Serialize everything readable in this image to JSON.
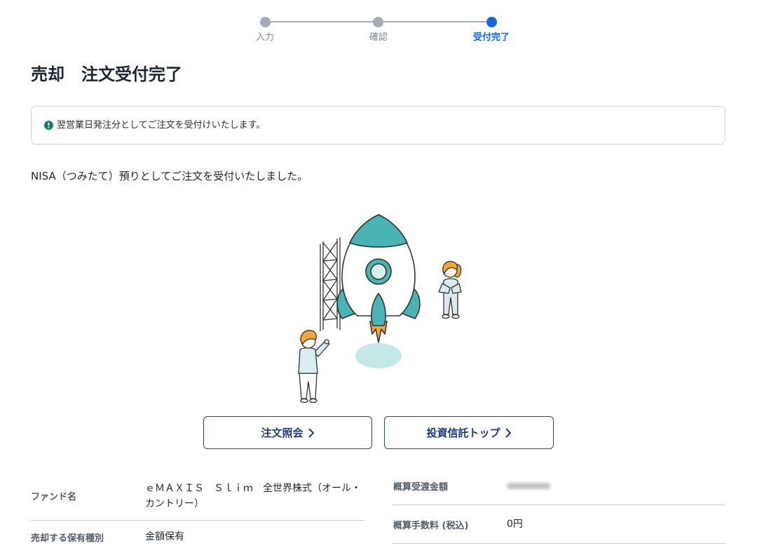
{
  "stepper": {
    "steps": [
      {
        "label": "入力",
        "state": "done"
      },
      {
        "label": "確認",
        "state": "done"
      },
      {
        "label": "受付完了",
        "state": "current"
      }
    ]
  },
  "page_title": "売却　注文受付完了",
  "notice": {
    "icon": "exclamation-circle-icon",
    "text": "翌営業日発注分としてご注文を受付けいたします。"
  },
  "message": "NISA（つみたて）預りとしてご注文を受付いたしました。",
  "illustration": {
    "icon": "rocket-launch-illustration"
  },
  "buttons": {
    "order_inquiry": "注文照会",
    "fund_top": "投資信託トップ",
    "chevron_icon": "chevron-right-icon"
  },
  "details_left": [
    {
      "label": "ファンド名",
      "value": "ｅＭＡＸＩＳ　Ｓｌｉｍ　全世界株式（オール・カントリー）"
    },
    {
      "label": "売却する保有種別",
      "value": "金額保有"
    }
  ],
  "details_right": [
    {
      "label": "概算受渡金額"
    },
    {
      "label": "概算手数料 (税込)",
      "value": "0円"
    }
  ],
  "colors": {
    "step_done": "#a3acb9",
    "step_current": "#1a66dc",
    "button_text": "#1f3a7a",
    "notice_icon": "#187a6a",
    "rocket_teal": "#4ab3b3",
    "flame_orange": "#f4a63b",
    "shadow": "#c3e8e5"
  }
}
